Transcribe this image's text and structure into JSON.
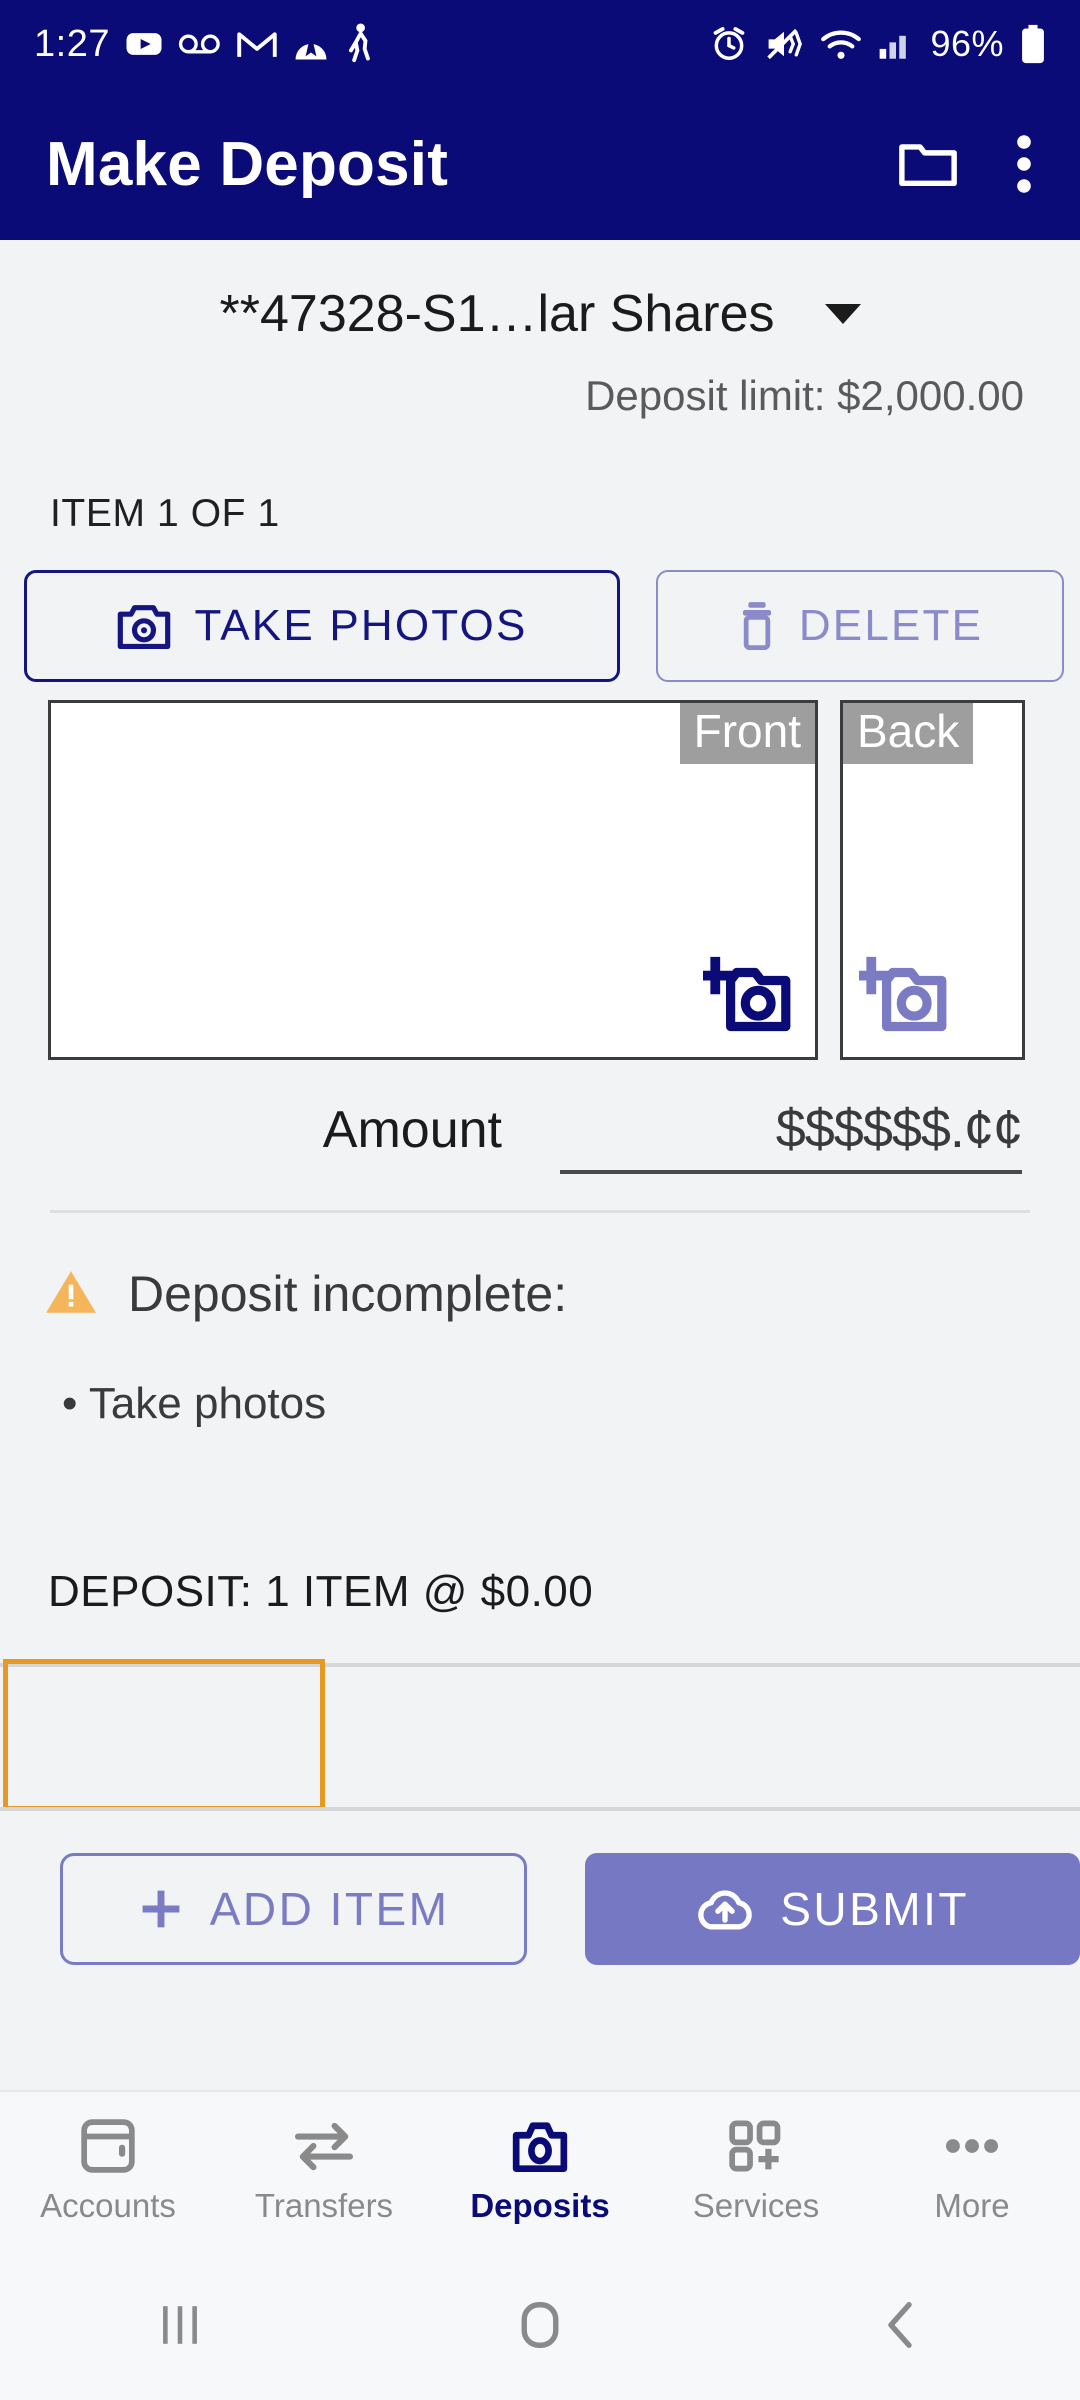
{
  "status_bar": {
    "time": "1:27",
    "battery_percent": "96%",
    "left_icons": [
      "youtube-icon",
      "voicemail-icon",
      "gmail-icon",
      "paramount-plus-icon",
      "walking-activity-icon"
    ],
    "right_icons": [
      "alarm-icon",
      "mute-vibrate-icon",
      "wifi-icon",
      "cellular-signal-icon",
      "battery-icon"
    ],
    "background_color": "#0b0b78"
  },
  "app_bar": {
    "title": "Make Deposit",
    "folder_action": "folder-icon",
    "overflow_action": "more-vertical-icon",
    "background_color": "#0b0b78"
  },
  "account": {
    "name": "**47328-S1…lar Shares",
    "dropdown_icon": "chevron-down-icon",
    "deposit_limit": "Deposit limit: $2,000.00"
  },
  "item": {
    "counter": "ITEM 1 OF 1",
    "take_photos_label": "TAKE PHOTOS",
    "take_photos_icon": "camera-icon",
    "delete_label": "DELETE",
    "delete_icon": "trash-icon",
    "take_photos_color": "#151580",
    "delete_color": "#8b8bc9"
  },
  "photos": {
    "front_tag": "Front",
    "back_tag": "Back",
    "front_icon": "add-a-photo-icon",
    "back_icon": "add-a-photo-icon",
    "front_icon_color": "#0b0b78",
    "back_icon_color": "#7b7bc4",
    "tag_background": "#9e9e9e"
  },
  "amount": {
    "label": "Amount",
    "value": "",
    "placeholder": "$$$$$$.¢¢"
  },
  "validation": {
    "warning_icon": "warning-triangle-icon",
    "warning_color": "#f5b65b",
    "heading": "Deposit incomplete:",
    "items": [
      "• Take photos"
    ]
  },
  "summary": {
    "text": "DEPOSIT: 1 ITEM @ $0.00",
    "highlight_box_color": "#e79a23"
  },
  "actions": {
    "add_item_label": "ADD ITEM",
    "add_item_icon": "plus-icon",
    "add_item_color": "#7b7bc4",
    "submit_label": "SUBMIT",
    "submit_icon": "cloud-upload-icon",
    "submit_background": "#7678c4"
  },
  "bottom_nav": {
    "active_color": "#0b0b78",
    "inactive_color": "#8a8a8a",
    "items": [
      {
        "label": "Accounts",
        "icon": "wallet-icon",
        "active": false
      },
      {
        "label": "Transfers",
        "icon": "transfer-arrows-icon",
        "active": false
      },
      {
        "label": "Deposits",
        "icon": "camera-icon",
        "active": true
      },
      {
        "label": "Services",
        "icon": "grid-plus-icon",
        "active": false
      },
      {
        "label": "More",
        "icon": "ellipsis-icon",
        "active": false
      }
    ]
  },
  "system_nav": {
    "items": [
      {
        "name": "recents-button",
        "icon": "three-bars-icon"
      },
      {
        "name": "home-button",
        "icon": "rounded-square-icon"
      },
      {
        "name": "back-button",
        "icon": "chevron-left-icon"
      }
    ]
  }
}
